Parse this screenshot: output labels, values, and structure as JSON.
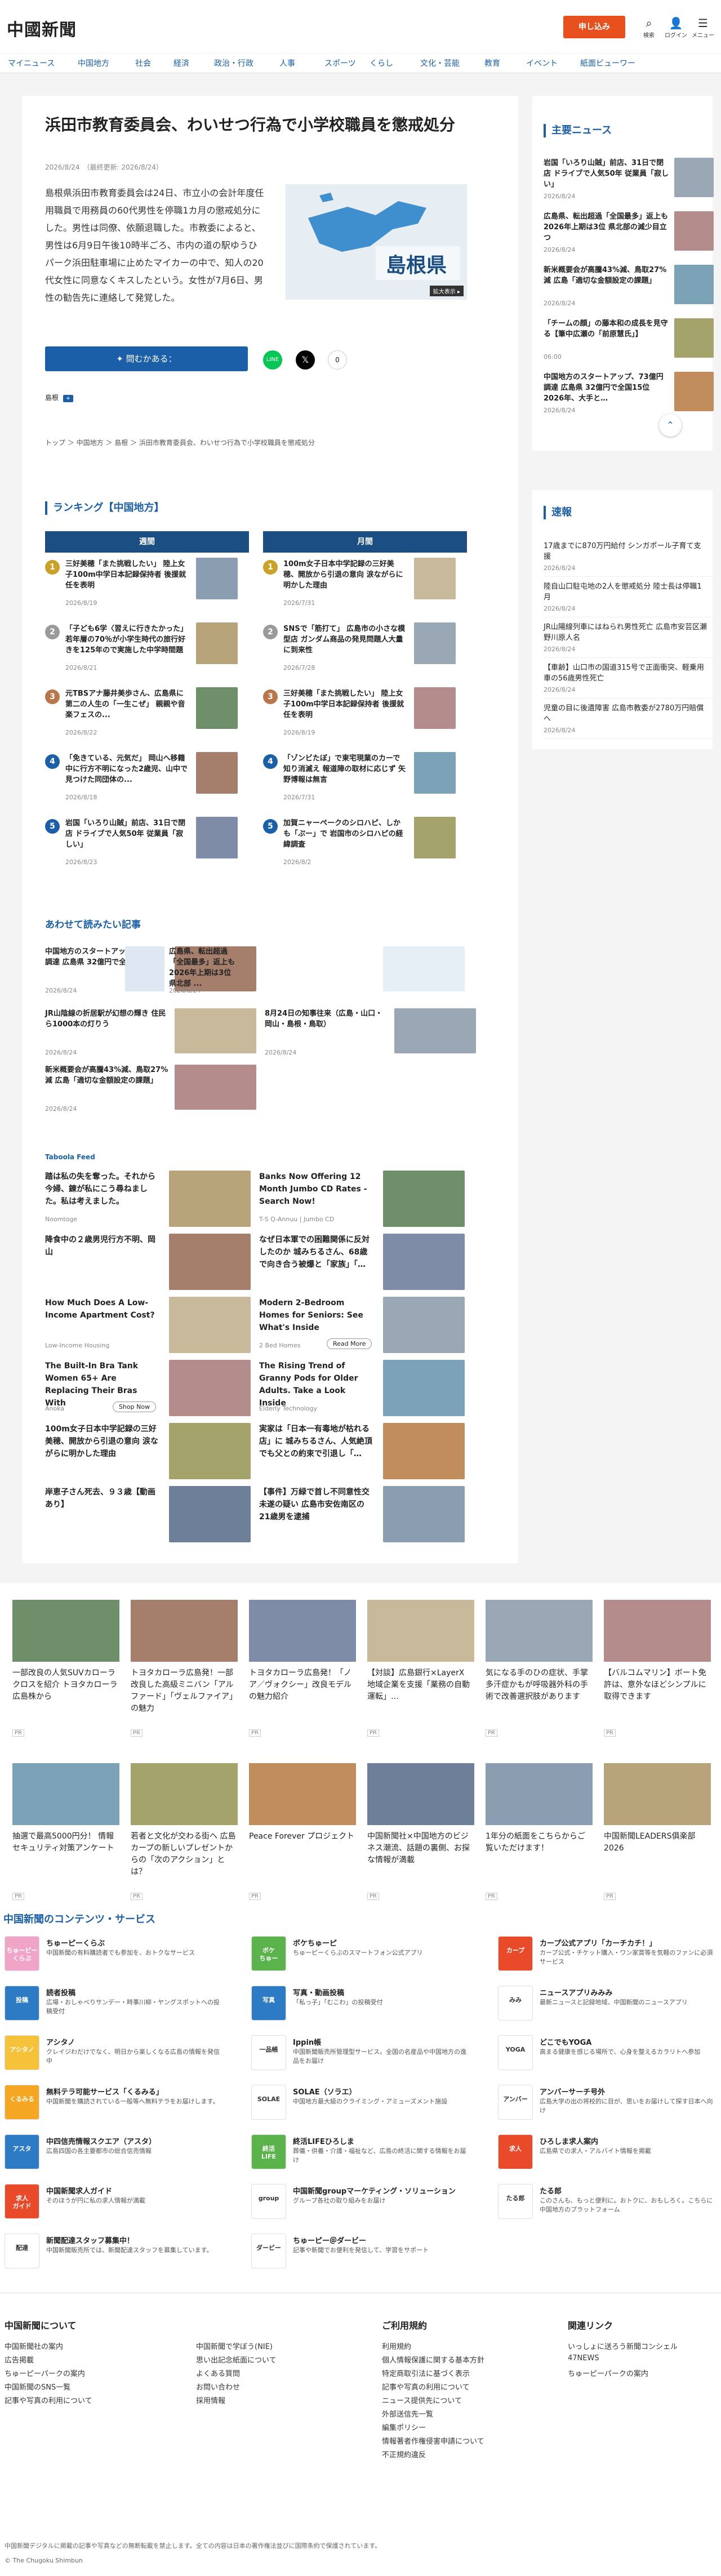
{
  "header": {
    "logo": "中國新聞",
    "subscribe": "申し込み",
    "icons": [
      {
        "name": "search-icon",
        "glyph": "⌕",
        "label": "検索"
      },
      {
        "name": "login-icon",
        "glyph": "👤",
        "label": "ログイン"
      },
      {
        "name": "menu-icon",
        "glyph": "☰",
        "label": "メニュー"
      }
    ]
  },
  "nav": [
    "マイニュース",
    "中国地方",
    "社会",
    "経済",
    "政治・行政",
    "人事",
    "スポーツ",
    "くらし",
    "文化・芸能",
    "教育",
    "イベント",
    "紙面ビューワー"
  ],
  "article": {
    "title": "浜田市教育委員会、わいせつ行為で小学校職員を懲戒処分",
    "date": "2026/8/24",
    "updated": "（最終更新: 2026/8/24）",
    "body": "島根県浜田市教育委員会は24日、市立小の会計年度任用職員で用務員の60代男性を停職1カ月の懲戒処分にした。男性は同僚、依願退職した。市教委によると、男性は6月9日午後10時半ごろ、市内の道の駅ゆうひパーク浜田駐車場に止めたマイカーの中で、知人の20代女性に同意なくキスしたという。女性が7月6日、男性の勧告先に連絡して発覚した。",
    "map_label": "島根県",
    "map_tag": "拡大表示 ▸",
    "ai_btn": "✦ 問むかある：",
    "share_count": "0",
    "tag": "島根",
    "breadcrumb": "トップ ＞ 中国地方 ＞ 島根 ＞ 浜田市教育委員会、わいせつ行為で小学校職員を懲戒処分"
  },
  "ranking": {
    "title": "ランキング【中国地方】",
    "weekly_head": "週間",
    "monthly_head": "月間",
    "weekly": [
      {
        "no": "1",
        "title": "三好美穂「また挑戦したい」 陸上女子100m中学日本記録保持者 後援就任を表明",
        "date": "2026/8/19",
        "color": "#c9a227"
      },
      {
        "no": "2",
        "title": "「子ども6学〈習えに行きたかった」若年層の70％が小学生時代の旅行好きを125年ので実施した中学時間題",
        "date": "2026/8/21",
        "color": "#9a9a9a"
      },
      {
        "no": "3",
        "title": "元TBSアナ藤井美歩さん、広島県に第二の人生の「一生こぜ」 親親や音楽フェスの...",
        "date": "2026/8/22",
        "color": "#b8764a"
      },
      {
        "no": "4",
        "title": "「免きている、元気だ」 岡山へ移籍中に行方不明になった2歳児、山中で見つけた同団体の...",
        "date": "2026/8/18",
        "color": "#1b5fa8"
      },
      {
        "no": "5",
        "title": "岩国「いろり山賊」前店、31日で閉店 ドライブで人気50年 従業員「寂しい」",
        "date": "2026/8/23",
        "color": "#1b5fa8"
      }
    ],
    "monthly": [
      {
        "no": "1",
        "title": "100m女子日本中学記録の三好美穂、開放から引退の意向 涙ながらに明かした理由",
        "date": "2026/7/31",
        "color": "#c9a227"
      },
      {
        "no": "2",
        "title": "SNSで「筋打て」 広島市の小さな模型店 ガンダム商品の発見問題人大量に到来性",
        "date": "2026/7/28",
        "color": "#9a9a9a"
      },
      {
        "no": "3",
        "title": "三好美穂「また挑戦したい」 陸上女子100m中学日本記録保持者 後援就任を表明",
        "date": "2026/8/19",
        "color": "#b8764a"
      },
      {
        "no": "4",
        "title": "「ゾンビたぼ」で東宅現業のカーで知り消滅え 報道陣の取材に応じず 矢野博報は無言",
        "date": "2026/7/31",
        "color": "#1b5fa8"
      },
      {
        "no": "5",
        "title": "加賀ニャーペークのシロハピ、しかも「ぷー」で 岩国市のシロハピの経緯調査",
        "date": "2026/8/2",
        "color": "#1b5fa8"
      }
    ]
  },
  "related": {
    "title": "あわせて読みたい記事",
    "items": [
      {
        "title": "中国地方のスタートアップ、73億円調達 広島県 32億円で全国15位 ...",
        "date": "2026/8/24"
      },
      {
        "title": "広島県、転出超過「全国最多」返上も 2026年上期は3位 県北部 ...",
        "date": "2026/8/24"
      },
      {
        "title": "JR山陰線の折居駅が幻想の輝き 住民ら1000本の灯りう",
        "date": "2026/8/24"
      },
      {
        "title": "8月24日の知事往来（広島・山口・岡山・島根・鳥取）",
        "date": "2026/8/24"
      },
      {
        "title": "新米概要会が高騰43%減、鳥取27%減 広島「適切な金額設定の課題」",
        "date": "2026/8/24"
      }
    ]
  },
  "taboola": {
    "logo": "Taboola Feed",
    "items": [
      {
        "title": "踏は私の失を奪った。それから今婦、錬が私にこう尋ねました。私は考えました。",
        "src": "Noomtoge"
      },
      {
        "title": "Banks Now Offering 12 Month Jumbo CD Rates - Search Now!",
        "src": "T-S Q-Annuu | Jumbo CD"
      },
      {
        "title": "降食中の２歳男児行方不明、岡山",
        "src": ""
      },
      {
        "title": "なぜ日本軍での困難関係に反対したのか 城みちるさん、68歳で向き合う被爆と「家族」「…",
        "src": ""
      },
      {
        "title": "How Much Does A Low-Income Apartment Cost?",
        "src": "Low-Income Housing"
      },
      {
        "title": "Modern 2-Bedroom Homes for Seniors: See What's Inside",
        "src": "2 Bed Homes",
        "cta": "Read More"
      },
      {
        "title": "The Built-In Bra Tank Women 65+ Are Replacing Their Bras With",
        "src": "Anoka",
        "cta": "Shop Now"
      },
      {
        "title": "The Rising Trend of Granny Pods for Older Adults. Take a Look Inside",
        "src": "Elderly Technology"
      },
      {
        "title": "100m女子日本中学記録の三好美穂、開放から引退の意向 涙ながらに明かした理由",
        "src": ""
      },
      {
        "title": "実家は「日本一有毒地が枯れる店」に 城みちるさん、人気絶頂でも父との約束で引退し「…",
        "src": ""
      },
      {
        "title": "岸恵子さん死去、９３歳【動画あり】",
        "src": ""
      },
      {
        "title": "【事件】万緑で首し不同意性交未遂の疑い 広島市安佐南区の21歳男を逮捕",
        "src": ""
      }
    ]
  },
  "sidebar": {
    "main_title": "主要ニュース",
    "main": [
      {
        "title": "岩国「いろり山賊」前店、31日で閉店 ドライブで人気50年 従業員「寂しい」",
        "date": "2026/8/24"
      },
      {
        "title": "広島県、転出超過「全国最多」返上も 2026年上期は3位 県北部の減少目立つ",
        "date": "2026/8/24"
      },
      {
        "title": "新米概要会が高騰43%減、鳥取27%減 広島「適切な金額設定の課題」",
        "date": "2026/8/24"
      },
      {
        "title": "「チームの顔」の藤本和の成長を見守る【筆中広瀬の「前原慧氏」】",
        "date": "06:00"
      },
      {
        "title": "中国地方のスタートアップ、73億円調達 広島県 32億円で全国15位 2026年、大手と…",
        "date": "2026/8/24"
      }
    ],
    "flash_title": "速報",
    "flash": [
      {
        "title": "17歳までに870万円給付 シンガポール子育て支援",
        "date": "2026/8/24"
      },
      {
        "title": "陸自山口駐屯地の2人を懲戒処分 陸士長は停職1月",
        "date": "2026/8/24"
      },
      {
        "title": "JR山陽線列車にはねられ男性死亡 広島市安芸区瀬野川原人名",
        "date": "2026/8/24"
      },
      {
        "title": "【車齢】山口市の国道315号で正面衝突、軽乗用車の56歳男性死亡",
        "date": "2026/8/24"
      },
      {
        "title": "児童の目に後遺障害 広島市教委が2780万円賠償へ",
        "date": "2026/8/24"
      }
    ]
  },
  "pr": [
    {
      "title": "一部改良の人気SUVカローラ クロスを紹介 トヨタカローラ広島株から",
      "tag": "PR"
    },
    {
      "title": "トヨタカローラ広島発！一部改良した高級ミニバン「アルファード」「ヴェルファイア」の魅力",
      "tag": "PR"
    },
    {
      "title": "トヨタカローラ広島発！「ノア／ヴォクシー」改良モデルの魅力紹介",
      "tag": "PR"
    },
    {
      "title": "【対談】広島銀行×LayerX 地域企業を支援「業務の自動運転」…",
      "tag": "PR"
    },
    {
      "title": "気になる手のひの症状、手掌多汗症かもが呼吸器外科の手術で改善選択肢があります",
      "tag": "PR"
    },
    {
      "title": "【バルコムマリン】ボート免許は、意外なほどシンプルに取得できます",
      "tag": "PR"
    },
    {
      "title": "抽選で最高5000円分！ 情報セキュリティ対策アンケート",
      "tag": "PR"
    },
    {
      "title": "若者と文化が交わる街へ 広島カープの新しいプレゼントからの「次のアクション」とは？",
      "tag": "PR"
    },
    {
      "title": "Peace Forever プロジェクト",
      "tag": "PR"
    },
    {
      "title": "中国新聞社×中国地方のビジネス潮流、話題の裏側、お探な情報が満載",
      "tag": "PR"
    },
    {
      "title": "1年分の紙面をこちらからご覧いただけます！",
      "tag": "PR"
    },
    {
      "title": "中国新聞LEADERS俱楽部2026",
      "tag": "PR"
    }
  ],
  "services": {
    "title": "中国新聞のコンテンツ・サービス",
    "items": [
      {
        "name": "ちゅーピーくらぶ",
        "desc": "中国新聞の有料購読者でも参加を、おトクなサービス",
        "icon": "ちゅーピー\nくらぶ",
        "color": "#f0a5c8"
      },
      {
        "name": "ボケちゅーピ",
        "desc": "ちゅーピーくらぶのスマートフォン公式アプリ",
        "icon": "ボケ\nちゅー",
        "color": "#5ab34b"
      },
      {
        "name": "カープ公式アプリ「カーチカチ！」",
        "desc": "カープ公式・チケット購入・ワン家賞等を気軽のファンに必須サービス",
        "icon": "カープ",
        "color": "#e84a2a"
      },
      {
        "name": "読者投稿",
        "desc": "広場・おしゃべりサンデー・時事川柳・ヤングスポットへの投稿受付",
        "icon": "投稿",
        "color": "#2d7bc5"
      },
      {
        "name": "写真・動画投稿",
        "desc": "「私っ子」「むこわ」の投稿受付",
        "icon": "写真",
        "color": "#2d7bc5"
      },
      {
        "name": "ニュースアプリみみみ",
        "desc": "最新ニュースと記録地域、中国新聞のニュースアプリ",
        "icon": "みみ",
        "color": "#ffffff"
      },
      {
        "name": "アシタノ",
        "desc": "クレイジわだけでなく、明日から楽しくなる広島の情報を発信中",
        "icon": "アシタノ",
        "color": "#f6c23a"
      },
      {
        "name": "Ippin帳",
        "desc": "中国新聞販売所管理型サービス。全国の名産品や中国地方の逸品をお届け",
        "icon": "一品帳",
        "color": "#ffffff"
      },
      {
        "name": "どこでもYOGA",
        "desc": "高まる健康を感じる場所で、心身を整えるカラリトへ参加",
        "icon": "YOGA",
        "color": "#ffffff"
      },
      {
        "name": "無料テラ可能サービス「くるみる」",
        "desc": "中国新聞を購読されている一般等へ無料テラをお届けします。",
        "icon": "くるみる",
        "color": "#f5a623"
      },
      {
        "name": "SOLAE（ソラエ）",
        "desc": "中国地方最大級のクライミング・アミューズメント施設",
        "icon": "SOLAE",
        "color": "#ffffff"
      },
      {
        "name": "アンバーサーチ号外",
        "desc": "広島大学の出の将校的に目が、思いをお届けして探す日本へ向け",
        "icon": "アンバー",
        "color": "#ffffff"
      },
      {
        "name": "中四信売情報スクエア（アスタ）",
        "desc": "広島四国の各主要都市の総合信売情報",
        "icon": "アスタ",
        "color": "#2d7bc5"
      },
      {
        "name": "終活LIFEひろしま",
        "desc": "葬儀・供養・介護・福祉など、広島の終活に関する情報をお届け",
        "icon": "終活\nLIFE",
        "color": "#5ab34b"
      },
      {
        "name": "ひろしま求人案内",
        "desc": "広島県での求人・アルバイト情報を掲載",
        "icon": "求人",
        "color": "#e84a2a"
      },
      {
        "name": "中国新聞求人ガイド",
        "desc": "そのほうが円に私の求人情報が満載",
        "icon": "求人\nガイド",
        "color": "#e84a2a"
      },
      {
        "name": "中国新聞groupマーケティング・ソリューション",
        "desc": "グループ各社の取り組みをお届け",
        "icon": "group",
        "color": "#ffffff"
      },
      {
        "name": "たる郎",
        "desc": "このさんも、もっと便利に。おトクに、おもしろく。こちらに中国地方のプラットフォーム",
        "icon": "たる郎",
        "color": "#ffffff"
      },
      {
        "name": "新聞配達スタッフ募集中！",
        "desc": "中国新聞販売所では、新聞配達スタッフを募集しています。",
        "icon": "配達",
        "color": "#ffffff"
      },
      {
        "name": "ちゅーピー＠ダービー",
        "desc": "記事や新聞でお便利を発信して、学習をサポート",
        "icon": "ダービー",
        "color": "#ffffff"
      }
    ]
  },
  "footer": {
    "col1_title": "中国新聞について",
    "col1": [
      "中国新聞社の案内",
      "広告掲載",
      "ちゅーピーパークの案内",
      "中国新聞のSNS一覧",
      "記事や写真の利用について"
    ],
    "col2": [
      "中国新聞で学ぼう(NIE)",
      "思い出記念紙面について",
      "よくある質問",
      "お問い合わせ",
      "採用情報"
    ],
    "col3_title": "ご利用規約",
    "col3": [
      "利用規約",
      "個人情報保護に関する基本方針",
      "特定商取引法に基づく表示",
      "記事や写真の利用について",
      "ニュース提供先について",
      "外部送信先一覧",
      "編集ポリシー",
      "情報著者作権侵害申請について",
      "不正規約違反"
    ],
    "col4_title": "関連リンク",
    "col4": [
      "いっしょに送ろう新聞コンシェル",
      "47NEWS",
      "ちゅーピーパークの案内"
    ],
    "notice": "中国新聞デジタルに掲載の記事や写真などの無断転載を禁止します。全ての内容は日本の著作権法並びに国際条約で保護されています。",
    "copyright": "© The Chugoku Shimbun"
  }
}
